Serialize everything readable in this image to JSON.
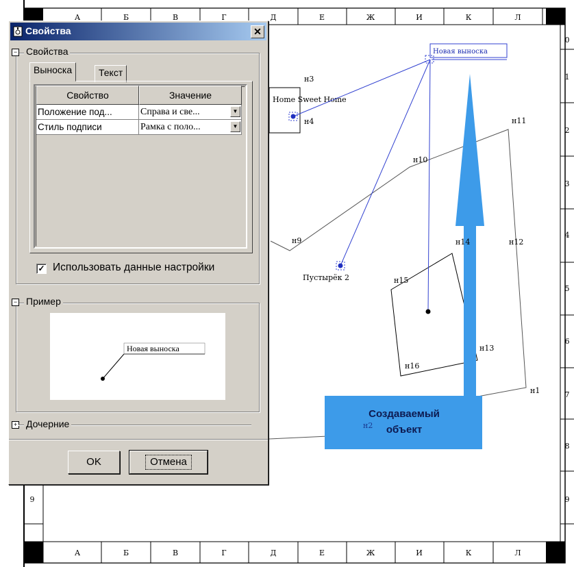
{
  "dialog": {
    "title": "Свойства",
    "close_glyph": "✕",
    "group_properties": "Свойства",
    "tabs": [
      "Выноска",
      "Текст"
    ],
    "table": {
      "headers": [
        "Свойство",
        "Значение"
      ],
      "rows": [
        {
          "property": "Положение под...",
          "value": "Справа и све..."
        },
        {
          "property": "Стиль подписи",
          "value": "Рамка с поло..."
        }
      ]
    },
    "use_settings_label": "Использовать данные настройки",
    "use_settings_checked": "✓",
    "group_example": "Пример",
    "example_callout": "Новая выноска",
    "group_children": "Дочерние",
    "ok_label": "OK",
    "cancel_label": "Отмена",
    "collapse_glyph": "−",
    "expand_glyph": "+"
  },
  "map": {
    "columns": [
      "А",
      "Б",
      "В",
      "Г",
      "Д",
      "Е",
      "Ж",
      "И",
      "К",
      "Л"
    ],
    "rows": [
      "0",
      "1",
      "2",
      "3",
      "4",
      "5",
      "6",
      "7",
      "8",
      "9"
    ],
    "left_row_label": "9",
    "callout_title": "Новая выноска",
    "text_home": "Home Sweet Home",
    "text_pustyrek": "Пустырёк 2",
    "object_label_line1": "Создаваемый",
    "object_label_line2": "объект",
    "node_labels": [
      "н1",
      "н2",
      "н3",
      "н4",
      "н9",
      "н10",
      "н11",
      "н12",
      "н13",
      "н14",
      "н15",
      "н16"
    ],
    "colors": {
      "arrow": "#3d9be9",
      "callout": "#3040d0",
      "lines": "#555555"
    }
  }
}
